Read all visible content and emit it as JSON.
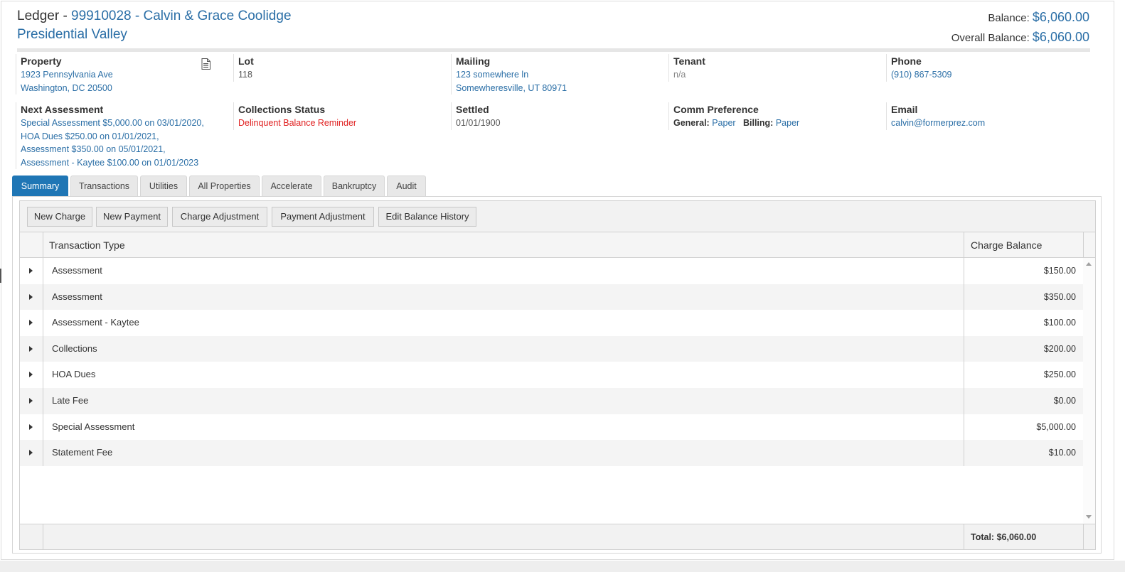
{
  "header": {
    "title_prefix": "Ledger - ",
    "account": "99910028 - Calvin & Grace Coolidge",
    "community": "Presidential Valley",
    "balance_label": "Balance: ",
    "balance": "$6,060.00",
    "overall_label": "Overall Balance: ",
    "overall": "$6,060.00"
  },
  "info": {
    "property": {
      "label": "Property",
      "line1": "1923 Pennsylvania Ave",
      "line2": "Washington, DC 20500",
      "icon": "document-icon"
    },
    "lot": {
      "label": "Lot",
      "value": "118"
    },
    "mailing": {
      "label": "Mailing",
      "line1": "123 somewhere ln",
      "line2": "Somewheresville, UT 80971"
    },
    "tenant": {
      "label": "Tenant",
      "value": "n/a"
    },
    "phone": {
      "label": "Phone",
      "value": "(910) 867-5309"
    },
    "next_assessment": {
      "label": "Next Assessment",
      "lines": [
        "Special Assessment $5,000.00 on 03/01/2020,",
        "HOA Dues $250.00 on 01/01/2021,",
        "Assessment $350.00 on 05/01/2021,",
        "Assessment - Kaytee $100.00 on 01/01/2023"
      ]
    },
    "collections": {
      "label": "Collections Status",
      "value": "Delinquent Balance Reminder",
      "color": "#e02020"
    },
    "settled": {
      "label": "Settled",
      "value": "01/01/1900"
    },
    "comm": {
      "label": "Comm Preference",
      "general_label": "General:",
      "general": "Paper",
      "billing_label": "Billing:",
      "billing": "Paper"
    },
    "email": {
      "label": "Email",
      "value": "calvin@formerprez.com"
    }
  },
  "tabs": [
    "Summary",
    "Transactions",
    "Utilities",
    "All Properties",
    "Accelerate",
    "Bankruptcy",
    "Audit"
  ],
  "active_tab": "Summary",
  "toolbar": [
    "New Charge",
    "New Payment",
    "Charge Adjustment",
    "Payment Adjustment",
    "Edit Balance History"
  ],
  "grid": {
    "columns": {
      "type": "Transaction Type",
      "balance": "Charge Balance"
    },
    "rows": [
      {
        "type": "Assessment",
        "balance": "$150.00"
      },
      {
        "type": "Assessment",
        "balance": "$350.00"
      },
      {
        "type": "Assessment - Kaytee",
        "balance": "$100.00"
      },
      {
        "type": "Collections",
        "balance": "$200.00"
      },
      {
        "type": "HOA Dues",
        "balance": "$250.00"
      },
      {
        "type": "Late Fee",
        "balance": "$0.00"
      },
      {
        "type": "Special Assessment",
        "balance": "$5,000.00"
      },
      {
        "type": "Statement Fee",
        "balance": "$10.00"
      }
    ],
    "total": "Total: $6,060.00"
  },
  "colors": {
    "link": "#2a6ea6",
    "accent": "#1f76b5",
    "alert": "#e02020"
  }
}
